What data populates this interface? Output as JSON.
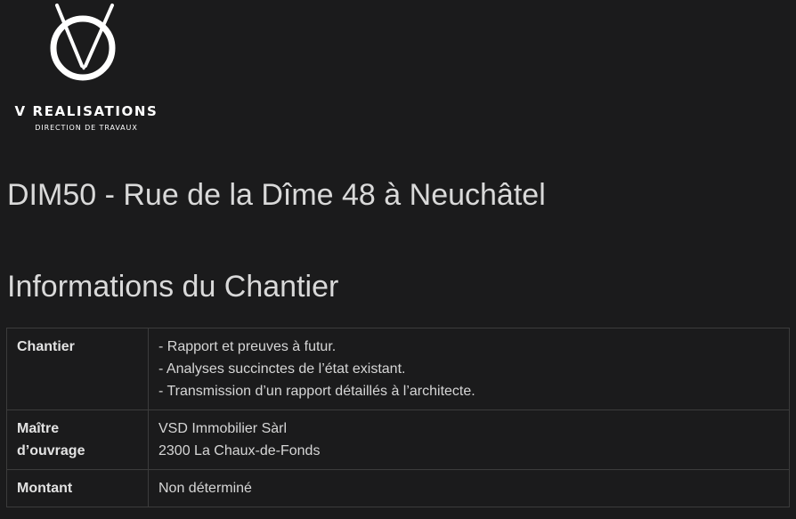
{
  "logo": {
    "title": "V REALISATIONS",
    "subtitle": "DIRECTION DE TRAVAUX",
    "icon": "v-realisations-logo-icon"
  },
  "page": {
    "title": "DIM50 - Rue de la Dîme 48 à Neuchâtel",
    "section_title": "Informations du Chantier"
  },
  "info_table": {
    "rows": [
      {
        "label": "Chantier",
        "lines": [
          "- Rapport et preuves à futur.",
          "- Analyses succinctes de l’état existant.",
          "- Transmission d’un rapport détaillés à l’architecte."
        ]
      },
      {
        "label_lines": [
          "Maître",
          "d’ouvrage"
        ],
        "lines": [
          "VSD Immobilier Sàrl",
          "2300 La Chaux-de-Fonds"
        ]
      },
      {
        "label": "Montant",
        "lines": [
          "Non déterminé"
        ]
      }
    ]
  },
  "colors": {
    "background": "#1b1b1c",
    "text": "#d9d9d9",
    "border": "#3c3c3c"
  }
}
